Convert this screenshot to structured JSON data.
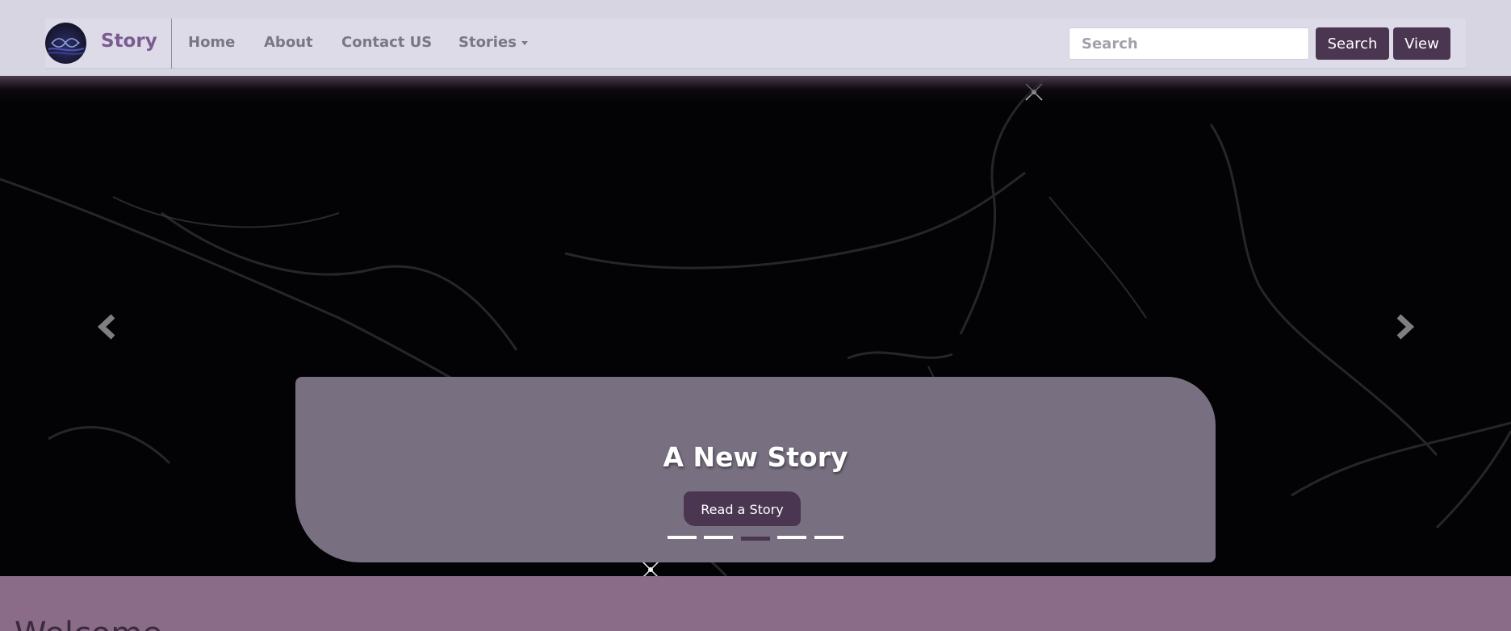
{
  "navbar": {
    "brand": "Story",
    "links": [
      {
        "label": "Home"
      },
      {
        "label": "About"
      },
      {
        "label": "Contact US"
      },
      {
        "label": "Stories",
        "dropdown": true
      }
    ],
    "search": {
      "placeholder": "Search",
      "value": ""
    },
    "search_button": "Search",
    "view_button": "View"
  },
  "carousel": {
    "caption_title": "A New Story",
    "caption_button": "Read a Story",
    "slide_count": 5,
    "active_index": 2,
    "prev_icon": "chevron-left-icon",
    "next_icon": "chevron-right-icon"
  },
  "welcome": {
    "heading": "Welcome"
  },
  "colors": {
    "page_bg": "#d6d5e1",
    "navbar_bg": "#dddbe7",
    "brand": "#7a5b92",
    "accent_dark": "#4b3652",
    "caption_bg": "#7c7485",
    "section_bg": "#8a6b88"
  }
}
